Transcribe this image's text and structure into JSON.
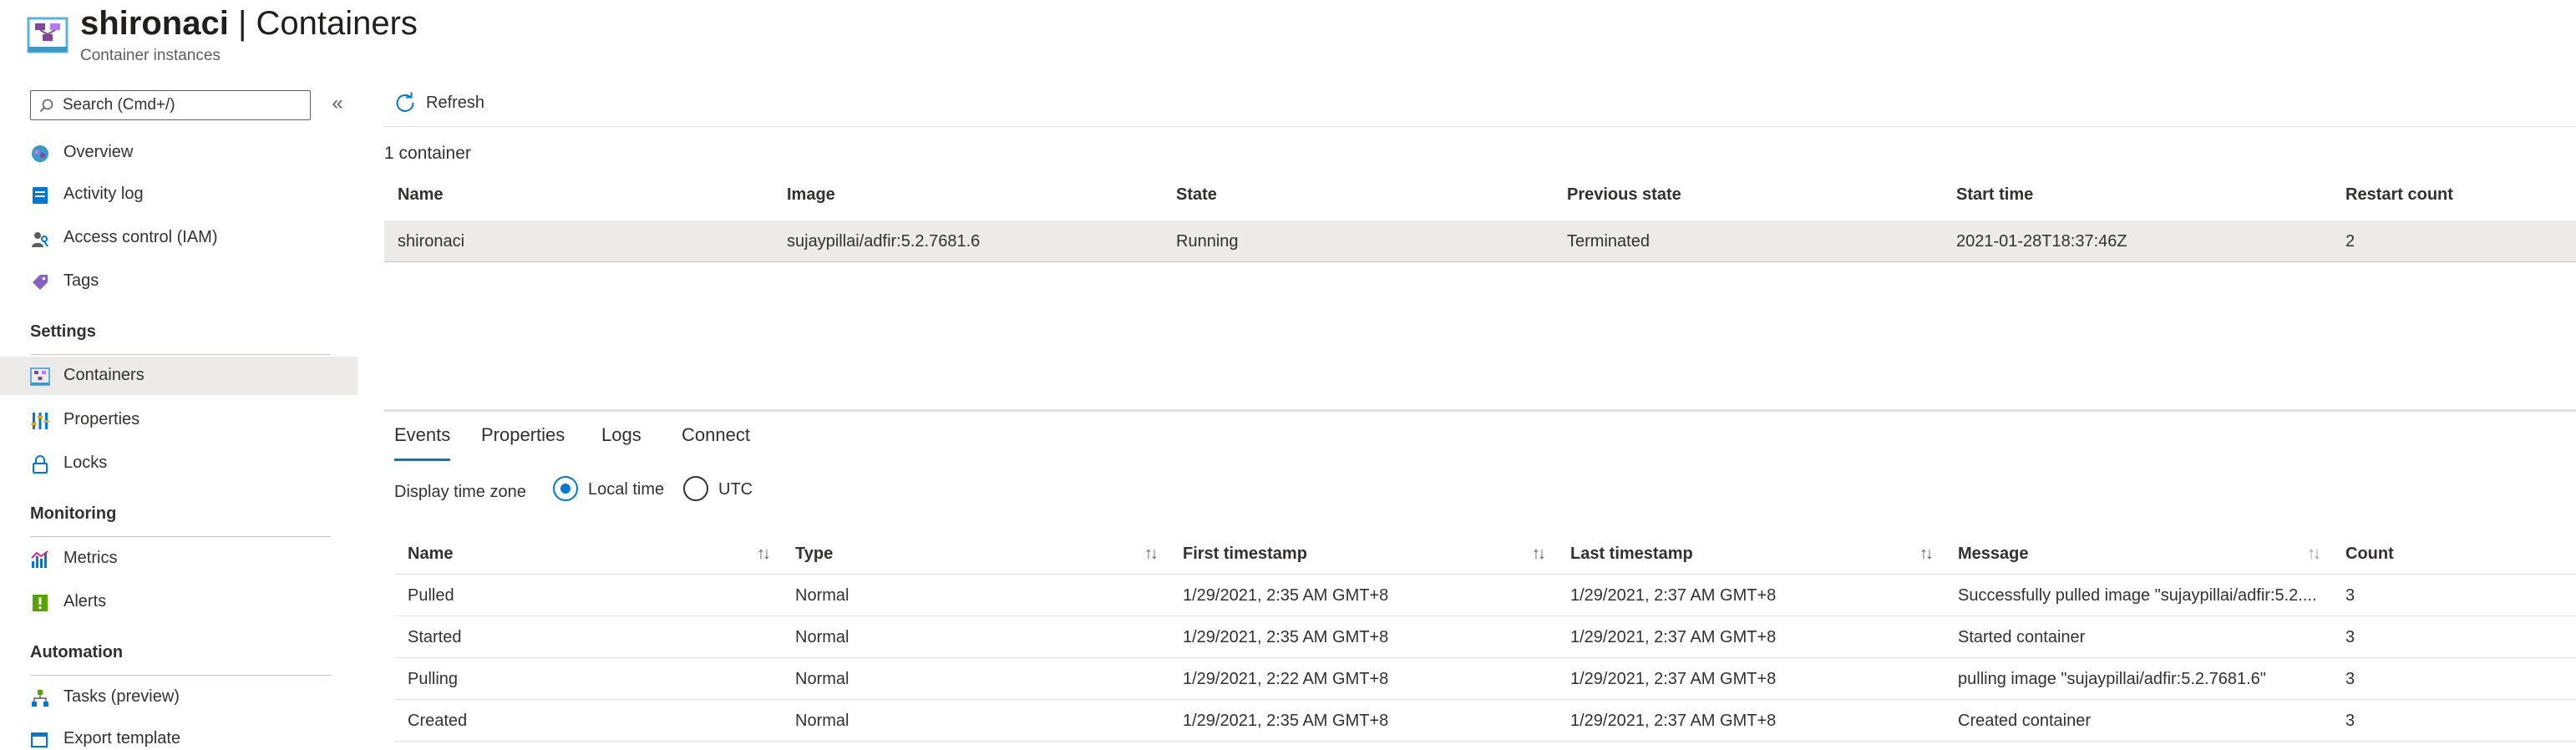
{
  "header": {
    "resource_name": "shironaci",
    "separator": "|",
    "page_name": "Containers",
    "subtitle": "Container instances"
  },
  "sidebar": {
    "search_placeholder": "Search (Cmd+/)",
    "collapse_glyph": "«",
    "items": [
      {
        "label": "Overview",
        "icon": "overview-icon"
      },
      {
        "label": "Activity log",
        "icon": "activity-log-icon"
      },
      {
        "label": "Access control (IAM)",
        "icon": "iam-icon"
      },
      {
        "label": "Tags",
        "icon": "tag-icon"
      }
    ],
    "sections": [
      {
        "title": "Settings",
        "items": [
          {
            "label": "Containers",
            "icon": "containers-icon",
            "active": true
          },
          {
            "label": "Properties",
            "icon": "properties-icon"
          },
          {
            "label": "Locks",
            "icon": "lock-icon"
          }
        ]
      },
      {
        "title": "Monitoring",
        "items": [
          {
            "label": "Metrics",
            "icon": "metrics-icon"
          },
          {
            "label": "Alerts",
            "icon": "alerts-icon"
          }
        ]
      },
      {
        "title": "Automation",
        "items": [
          {
            "label": "Tasks (preview)",
            "icon": "tasks-icon"
          },
          {
            "label": "Export template",
            "icon": "export-template-icon"
          }
        ]
      }
    ]
  },
  "toolbar": {
    "refresh_label": "Refresh"
  },
  "containers": {
    "count_label": "1 container",
    "columns": [
      "Name",
      "Image",
      "State",
      "Previous state",
      "Start time",
      "Restart count"
    ],
    "rows": [
      [
        "shironaci",
        "sujaypillai/adfir:5.2.7681.6",
        "Running",
        "Terminated",
        "2021-01-28T18:37:46Z",
        "2"
      ]
    ]
  },
  "tabs": [
    "Events",
    "Properties",
    "Logs",
    "Connect"
  ],
  "active_tab": "Events",
  "timezone": {
    "label": "Display time zone",
    "options": [
      "Local time",
      "UTC"
    ],
    "selected": "Local time"
  },
  "events": {
    "columns": [
      "Name",
      "Type",
      "First timestamp",
      "Last timestamp",
      "Message",
      "Count"
    ],
    "rows": [
      [
        "Pulled",
        "Normal",
        "1/29/2021, 2:35 AM GMT+8",
        "1/29/2021, 2:37 AM GMT+8",
        "Successfully pulled image \"sujaypillai/adfir:5.2....",
        "3"
      ],
      [
        "Started",
        "Normal",
        "1/29/2021, 2:35 AM GMT+8",
        "1/29/2021, 2:37 AM GMT+8",
        "Started container",
        "3"
      ],
      [
        "Pulling",
        "Normal",
        "1/29/2021, 2:22 AM GMT+8",
        "1/29/2021, 2:37 AM GMT+8",
        "pulling image \"sujaypillai/adfir:5.2.7681.6\"",
        "3"
      ],
      [
        "Created",
        "Normal",
        "1/29/2021, 2:35 AM GMT+8",
        "1/29/2021, 2:37 AM GMT+8",
        "Created container",
        "3"
      ]
    ]
  },
  "colors": {
    "accent": "#0078d4",
    "active_bg": "#edebe9",
    "text": "#323130"
  }
}
